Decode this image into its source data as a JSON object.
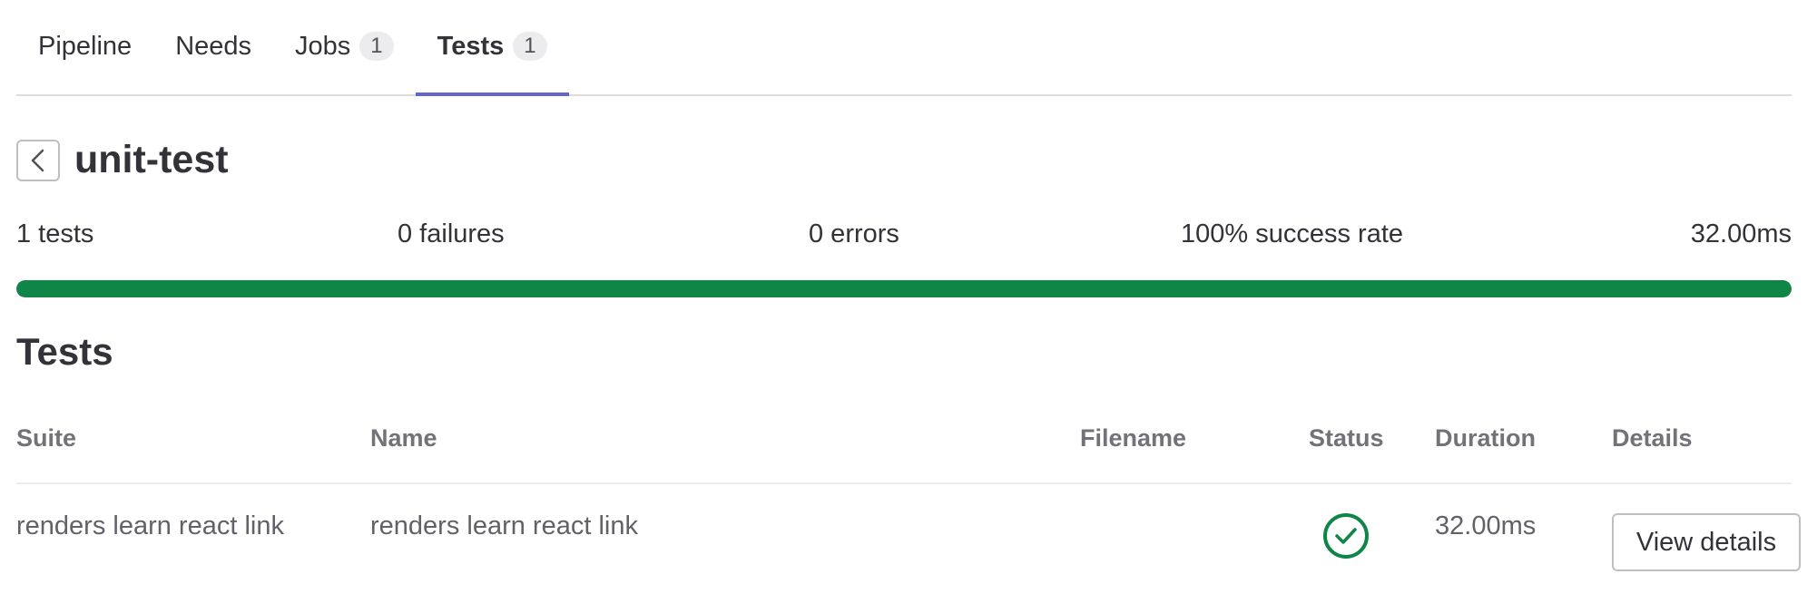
{
  "tabs": [
    {
      "label": "Pipeline"
    },
    {
      "label": "Needs"
    },
    {
      "label": "Jobs",
      "count": "1"
    },
    {
      "label": "Tests",
      "count": "1",
      "active": true
    }
  ],
  "header": {
    "back_icon": "chevron-left-icon",
    "title": "unit-test"
  },
  "summary": {
    "tests": "1 tests",
    "failures": "0 failures",
    "errors": "0 errors",
    "success_rate": "100% success rate",
    "duration": "32.00ms",
    "progress_fraction": 1.0,
    "progress_color": "#108548"
  },
  "tests_section": {
    "title": "Tests",
    "columns": {
      "suite": "Suite",
      "name": "Name",
      "filename": "Filename",
      "status": "Status",
      "duration": "Duration",
      "details": "Details"
    },
    "rows": [
      {
        "suite": "renders learn react link",
        "name": "renders learn react link",
        "filename": "",
        "status": "success",
        "status_icon": "check-circle-icon",
        "duration": "32.00ms",
        "details_button": "View details"
      }
    ]
  }
}
